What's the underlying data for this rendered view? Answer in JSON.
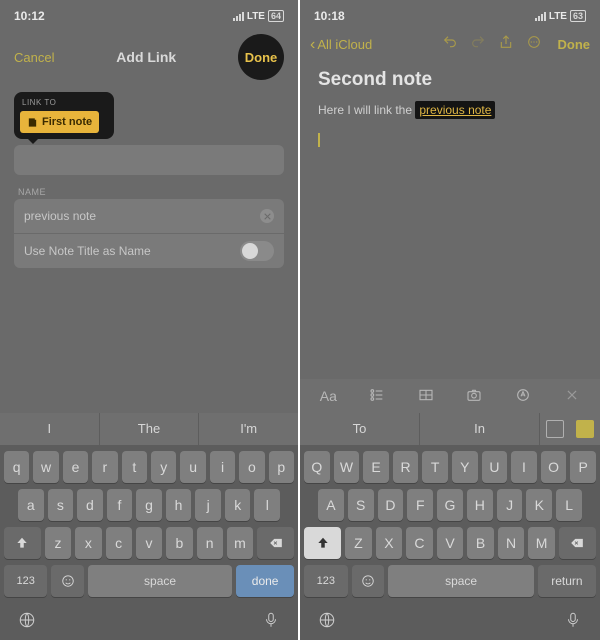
{
  "left": {
    "status": {
      "time": "10:12",
      "carrier": "LTE",
      "battery": "64"
    },
    "nav": {
      "cancel": "Cancel",
      "title": "Add Link",
      "done": "Done"
    },
    "popover": {
      "label": "LINK TO",
      "chip_label": "First note"
    },
    "name_section": {
      "label": "NAME",
      "value": "previous note",
      "toggle_label": "Use Note Title as Name"
    },
    "suggestions": [
      "I",
      "The",
      "I'm"
    ],
    "keyboard": {
      "row1": [
        "q",
        "w",
        "e",
        "r",
        "t",
        "y",
        "u",
        "i",
        "o",
        "p"
      ],
      "row2": [
        "a",
        "s",
        "d",
        "f",
        "g",
        "h",
        "j",
        "k",
        "l"
      ],
      "row3": [
        "z",
        "x",
        "c",
        "v",
        "b",
        "n",
        "m"
      ],
      "num": "123",
      "space": "space",
      "action": "done"
    }
  },
  "right": {
    "status": {
      "time": "10:18",
      "carrier": "LTE",
      "battery": "63"
    },
    "nav": {
      "back": "All iCloud",
      "done": "Done"
    },
    "note": {
      "title": "Second note",
      "body_prefix": "Here I will link the ",
      "link_text": "previous note"
    },
    "format_bar": {
      "aa": "Aa"
    },
    "suggestions": [
      "To",
      "In"
    ],
    "keyboard": {
      "row1": [
        "Q",
        "W",
        "E",
        "R",
        "T",
        "Y",
        "U",
        "I",
        "O",
        "P"
      ],
      "row2": [
        "A",
        "S",
        "D",
        "F",
        "G",
        "H",
        "J",
        "K",
        "L"
      ],
      "row3": [
        "Z",
        "X",
        "C",
        "V",
        "B",
        "N",
        "M"
      ],
      "num": "123",
      "space": "space",
      "action": "return"
    }
  }
}
